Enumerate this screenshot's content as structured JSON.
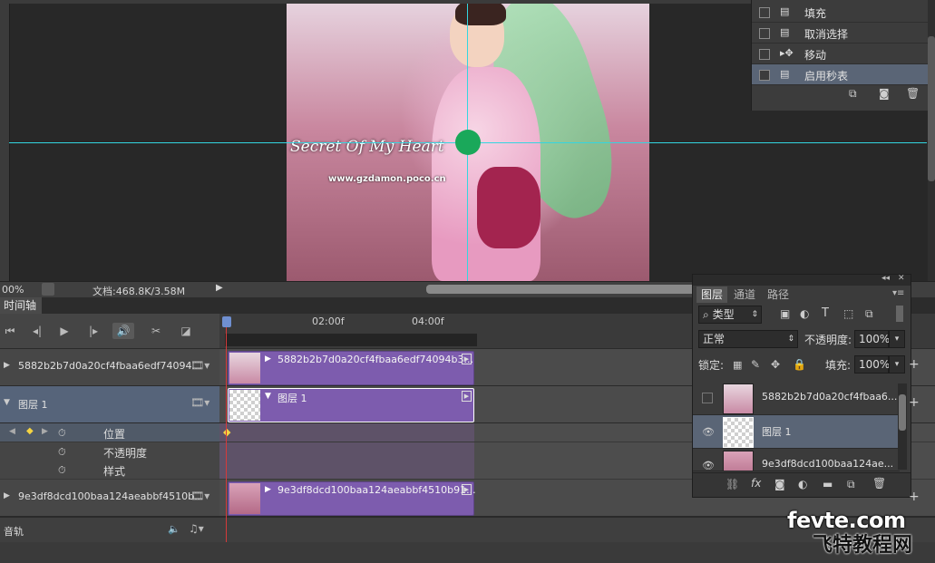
{
  "canvas": {
    "watermark_text": "Secret Of My Heart",
    "watermark_url": "www.gzdamon.poco.cn"
  },
  "history": {
    "items": [
      {
        "label": "填充",
        "icon": "document-icon",
        "selected": false
      },
      {
        "label": "取消选择",
        "icon": "document-icon",
        "selected": false
      },
      {
        "label": "移动",
        "icon": "move-tool-icon",
        "selected": false
      },
      {
        "label": "启用秒表",
        "icon": "document-icon",
        "selected": true
      }
    ]
  },
  "status": {
    "zoom": "00%",
    "doc_label": "文档:468.8K/3.58M"
  },
  "timeline": {
    "tab": "时间轴",
    "ticks": [
      "02:00f",
      "04:00f"
    ],
    "tracks": [
      {
        "name": "5882b2b7d0a20cf4fbaa6edf74094...",
        "clip": "5882b2b7d0a20cf4fbaa6edf74094b3..."
      },
      {
        "name": "图层 1",
        "clip": "图层 1"
      },
      {
        "name": "9e3df8dcd100baa124aeabbf4510b...",
        "clip": "9e3df8dcd100baa124aeabbf4510b91..."
      }
    ],
    "properties": [
      "位置",
      "不透明度",
      "样式"
    ],
    "audio_label": "音轨"
  },
  "layers": {
    "tabs": [
      "图层",
      "通道",
      "路径"
    ],
    "filter": "类型",
    "blend_mode": "正常",
    "opacity_label": "不透明度:",
    "opacity_value": "100%",
    "lock_label": "锁定:",
    "fill_label": "填充:",
    "fill_value": "100%",
    "items": [
      {
        "name": "5882b2b7d0a20cf4fbaa6..."
      },
      {
        "name": "图层 1"
      },
      {
        "name": "9e3df8dcd100baa124ae..."
      }
    ]
  },
  "logo": {
    "line1": "fevte.com",
    "line2": "飞特教程网"
  },
  "colors": {
    "guide": "#33d6e0",
    "clip": "#7d5cae",
    "selection": "#5a6576",
    "playhead": "#d43a3a"
  }
}
